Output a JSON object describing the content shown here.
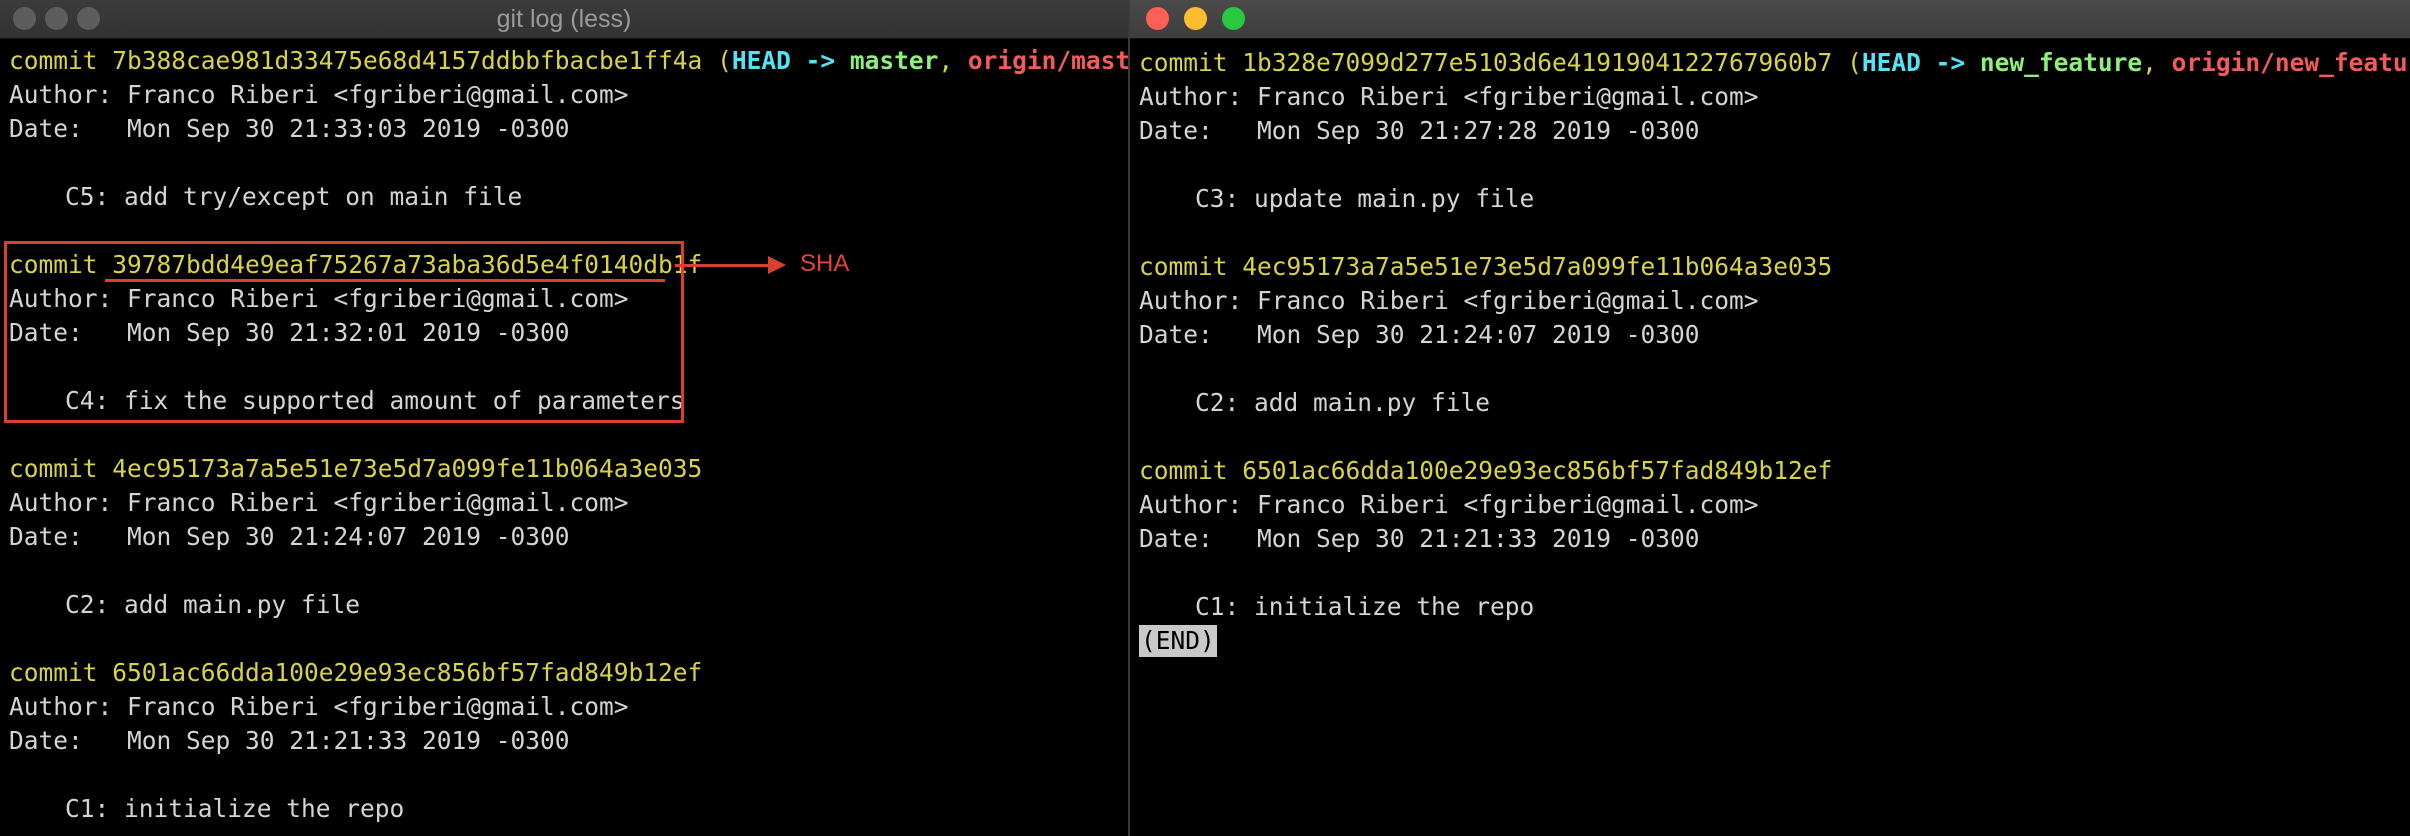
{
  "left_window": {
    "title": "git log (less)",
    "commits": [
      {
        "word": "commit",
        "hash": "7b388cae981d33475e68d4157ddbbfbacbe1ff4a",
        "head": "HEAD",
        "arrow": "->",
        "branch": "master",
        "remote": "origin/master",
        "author": "Author: Franco Riberi <fgriberi@gmail.com>",
        "date": "Date:   Mon Sep 30 21:33:03 2019 -0300",
        "message": "C5: add try/except on main file"
      },
      {
        "word": "commit",
        "hash": "39787bdd4e9eaf75267a73aba36d5e4f0140db1f",
        "author": "Author: Franco Riberi <fgriberi@gmail.com>",
        "date": "Date:   Mon Sep 30 21:32:01 2019 -0300",
        "message": "C4: fix the supported amount of parameters"
      },
      {
        "word": "commit",
        "hash": "4ec95173a7a5e51e73e5d7a099fe11b064a3e035",
        "author": "Author: Franco Riberi <fgriberi@gmail.com>",
        "date": "Date:   Mon Sep 30 21:24:07 2019 -0300",
        "message": "C2: add main.py file"
      },
      {
        "word": "commit",
        "hash": "6501ac66dda100e29e93ec856bf57fad849b12ef",
        "author": "Author: Franco Riberi <fgriberi@gmail.com>",
        "date": "Date:   Mon Sep 30 21:21:33 2019 -0300",
        "message": "C1: initialize the repo"
      }
    ]
  },
  "right_window": {
    "commits": [
      {
        "word": "commit",
        "hash": "1b328e7099d277e5103d6e4191904122767960b7",
        "head": "HEAD",
        "arrow": "->",
        "branch": "new_feature",
        "remote": "origin/new_feature",
        "author": "Author: Franco Riberi <fgriberi@gmail.com>",
        "date": "Date:   Mon Sep 30 21:27:28 2019 -0300",
        "message": "C3: update main.py file"
      },
      {
        "word": "commit",
        "hash": "4ec95173a7a5e51e73e5d7a099fe11b064a3e035",
        "author": "Author: Franco Riberi <fgriberi@gmail.com>",
        "date": "Date:   Mon Sep 30 21:24:07 2019 -0300",
        "message": "C2: add main.py file"
      },
      {
        "word": "commit",
        "hash": "6501ac66dda100e29e93ec856bf57fad849b12ef",
        "author": "Author: Franco Riberi <fgriberi@gmail.com>",
        "date": "Date:   Mon Sep 30 21:21:33 2019 -0300",
        "message": "C1: initialize the repo"
      }
    ],
    "end_marker": "(END)"
  },
  "annotation": {
    "label": "SHA",
    "color": "#d9402f"
  },
  "colors": {
    "hash": "#d7d247",
    "head": "#52e4f4",
    "branch": "#8ef07a",
    "remote": "#f25b5b",
    "text": "#d4d4d4"
  }
}
